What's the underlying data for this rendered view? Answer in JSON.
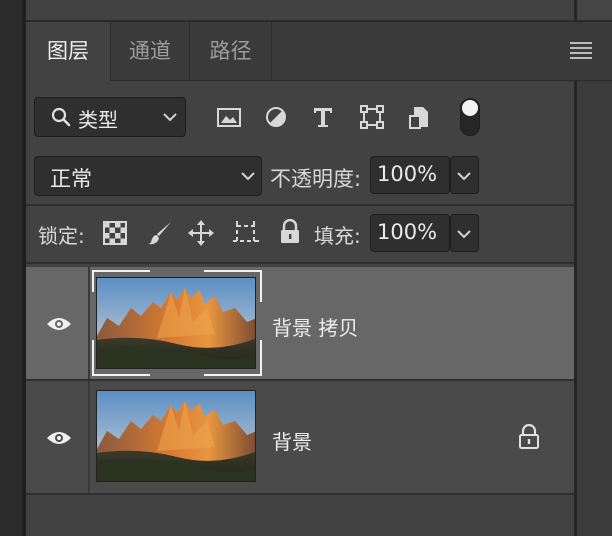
{
  "tabs": [
    {
      "label": "图层",
      "active": true
    },
    {
      "label": "通道",
      "active": false
    },
    {
      "label": "路径",
      "active": false
    }
  ],
  "filter": {
    "label": "类型",
    "icons": [
      "search-icon",
      "image-filter-icon",
      "adjustment-filter-icon",
      "type-filter-icon",
      "shape-filter-icon",
      "smart-object-filter-icon"
    ]
  },
  "blend": {
    "mode": "正常",
    "opacity_label": "不透明度:",
    "opacity_value": "100%"
  },
  "lock": {
    "label": "锁定:",
    "icons": [
      "lock-transparent-pixels-icon",
      "lock-image-pixels-icon",
      "lock-position-icon",
      "lock-artboard-icon",
      "lock-all-icon"
    ]
  },
  "fill": {
    "label": "填充:",
    "value": "100%"
  },
  "layers": [
    {
      "name": "背景 拷贝",
      "visible": true,
      "selected": true,
      "locked": false
    },
    {
      "name": "背景",
      "visible": true,
      "selected": false,
      "locked": true
    }
  ],
  "colors": {
    "panel": "#424242",
    "selected_row": "#676767",
    "row": "#4a4a4a",
    "field": "#2f2f2f"
  }
}
